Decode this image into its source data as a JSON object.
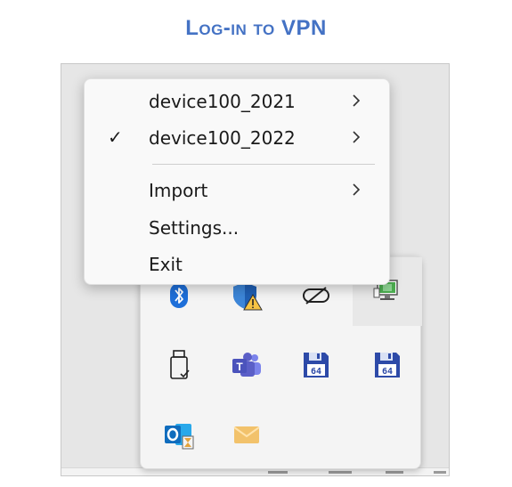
{
  "page": {
    "title": "Log-in to VPN"
  },
  "context_menu": {
    "items": [
      {
        "label": "device100_2021",
        "checked": false,
        "has_submenu": true
      },
      {
        "label": "device100_2022",
        "checked": true,
        "has_submenu": true
      },
      {
        "label": "Import",
        "checked": false,
        "has_submenu": true
      },
      {
        "label": "Settings...",
        "checked": false,
        "has_submenu": false
      },
      {
        "label": "Exit",
        "checked": false,
        "has_submenu": false
      }
    ],
    "check_glyph": "✓"
  },
  "tray_icons": [
    {
      "name": "bluetooth-icon"
    },
    {
      "name": "windows-security-warning-icon"
    },
    {
      "name": "disconnected-link-icon"
    },
    {
      "name": "vpn-monitor-icon"
    },
    {
      "name": "usb-drive-icon"
    },
    {
      "name": "teams-icon"
    },
    {
      "name": "save-64-icon"
    },
    {
      "name": "save-64-alt-icon"
    },
    {
      "name": "outlook-icon"
    },
    {
      "name": "mail-envelope-icon"
    }
  ],
  "colors": {
    "title": "#4472c4",
    "bluetooth": "#1e6fd9",
    "teams": "#5b5fc7",
    "floppy": "#2d4aa8",
    "outlook": "#0f6cbd",
    "envelope": "#f2c26b",
    "monitor": "#4caf50"
  }
}
